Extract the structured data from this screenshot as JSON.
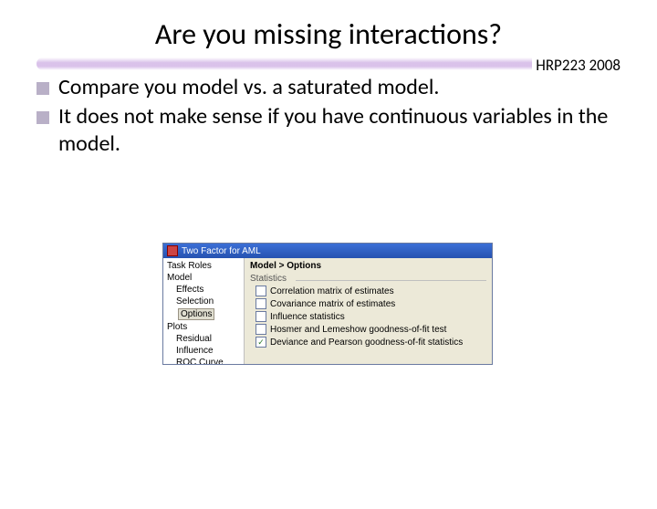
{
  "title": "Are you missing interactions?",
  "header_label": "HRP223 2008",
  "bullets": [
    "Compare you model vs. a saturated model.",
    "It does not make sense if you have continuous variables in the model."
  ],
  "dialog": {
    "title": "Two Factor for AML",
    "breadcrumb": "Model > Options",
    "tree": {
      "root0": "Task Roles",
      "root1": "Model",
      "sub_effects": "Effects",
      "sub_selection": "Selection",
      "sub_options": "Options",
      "root2": "Plots",
      "sub_residual": "Residual",
      "sub_influence": "Influence",
      "sub_roc": "ROC Curve"
    },
    "group_label": "Statistics",
    "options": [
      {
        "label": "Correlation matrix of estimates",
        "checked": false
      },
      {
        "label": "Covariance matrix of estimates",
        "checked": false
      },
      {
        "label": "Influence statistics",
        "checked": false
      },
      {
        "label": "Hosmer and Lemeshow goodness-of-fit test",
        "checked": false
      },
      {
        "label": "Deviance and Pearson goodness-of-fit statistics",
        "checked": true
      }
    ]
  }
}
